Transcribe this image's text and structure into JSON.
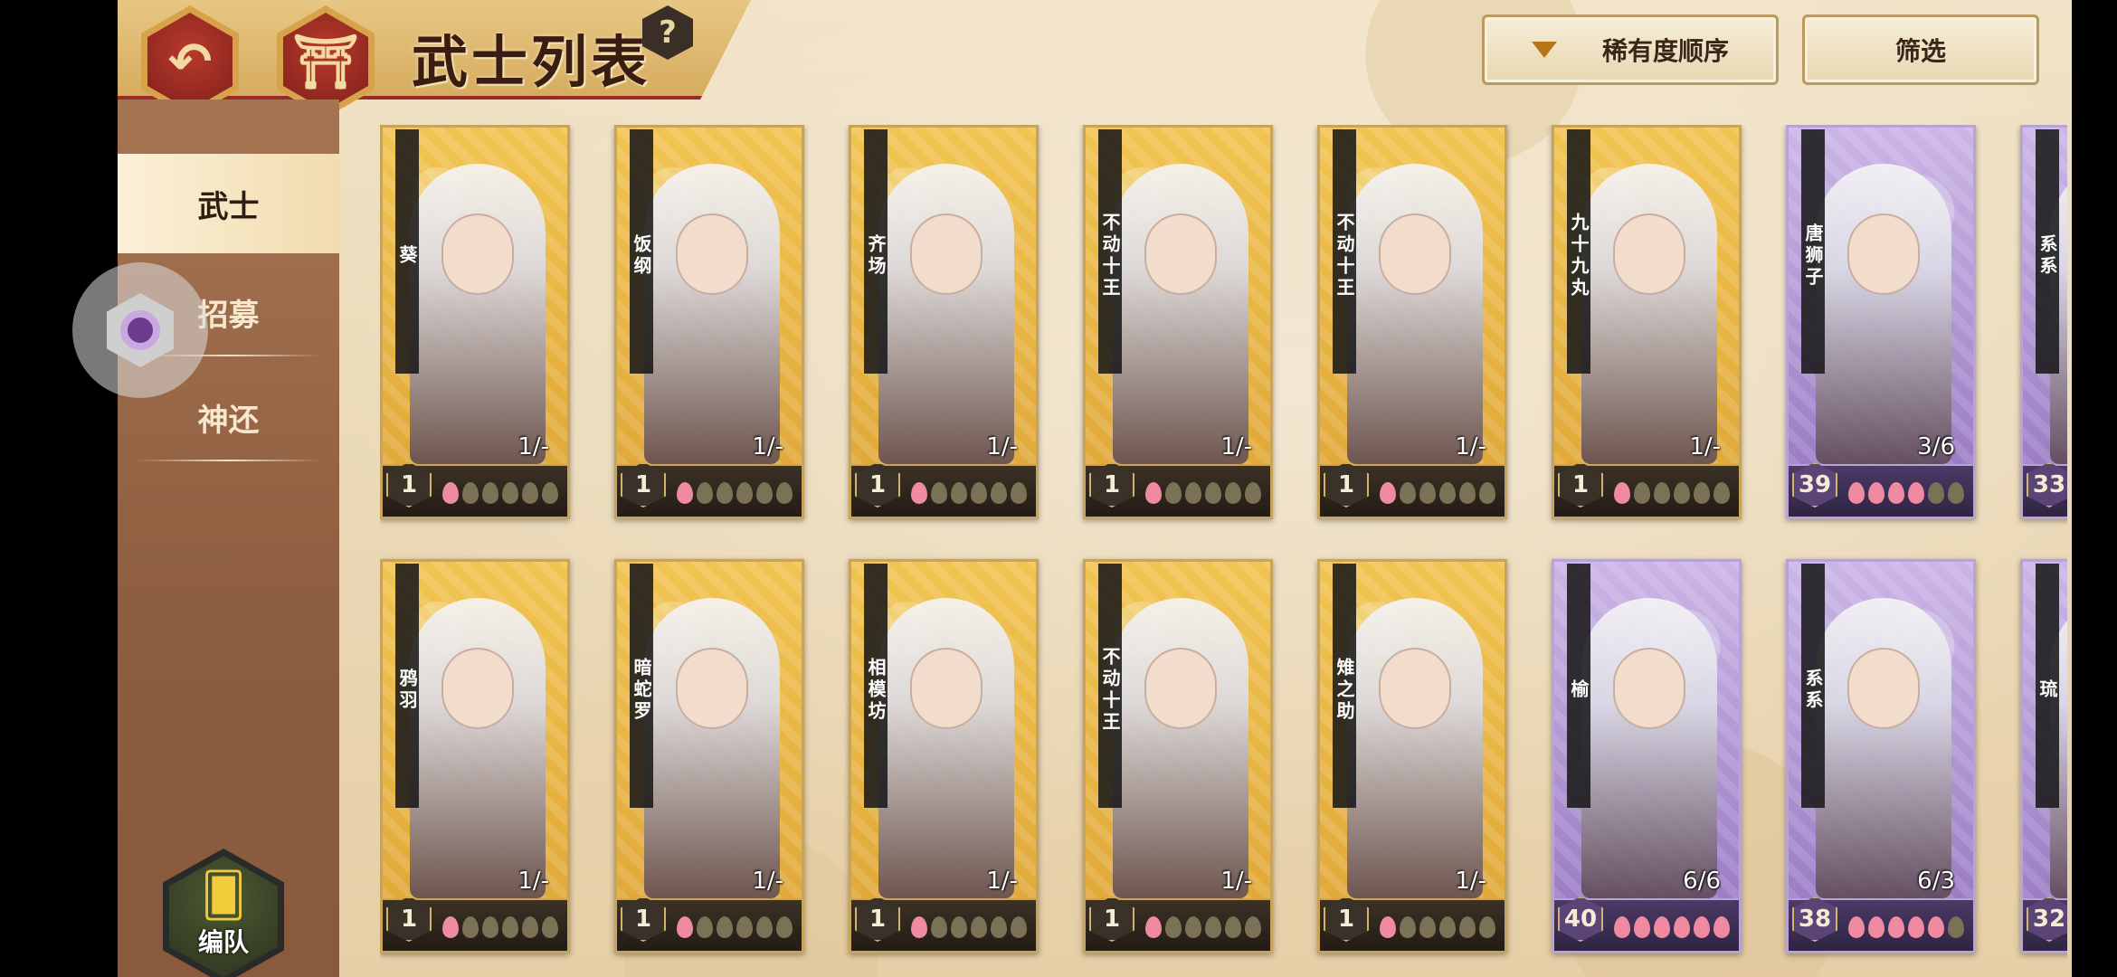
{
  "header": {
    "title": "武士列表",
    "back_icon": "back-arrow-icon",
    "home_icon": "torii-home-icon",
    "help_label": "?"
  },
  "toolbar": {
    "sort_label": "稀有度顺序",
    "filter_label": "筛选"
  },
  "sidebar": {
    "items": [
      {
        "label": "武士",
        "active": true
      },
      {
        "label": "招募",
        "active": false
      },
      {
        "label": "神还",
        "active": false
      }
    ],
    "team_button_label": "编队"
  },
  "colors": {
    "accent_red": "#9b2a2a",
    "gold": "#d6ac5f",
    "sidebar_brown": "#8d5d3f",
    "petal_pink": "#ef8aa1"
  },
  "cards": [
    {
      "name": "葵",
      "level": "1",
      "count": "1/-",
      "petals_total": 6,
      "petals_on": 1,
      "rarity": "gold"
    },
    {
      "name": "饭纲",
      "level": "1",
      "count": "1/-",
      "petals_total": 6,
      "petals_on": 1,
      "rarity": "gold"
    },
    {
      "name": "齐场",
      "level": "1",
      "count": "1/-",
      "petals_total": 6,
      "petals_on": 1,
      "rarity": "gold"
    },
    {
      "name": "不动十王",
      "level": "1",
      "count": "1/-",
      "petals_total": 6,
      "petals_on": 1,
      "rarity": "gold"
    },
    {
      "name": "不动十王",
      "level": "1",
      "count": "1/-",
      "petals_total": 6,
      "petals_on": 1,
      "rarity": "gold"
    },
    {
      "name": "九十九丸",
      "level": "1",
      "count": "1/-",
      "petals_total": 6,
      "petals_on": 1,
      "rarity": "gold"
    },
    {
      "name": "唐狮子",
      "level": "39",
      "count": "3/6",
      "petals_total": 6,
      "petals_on": 4,
      "rarity": "purple"
    },
    {
      "name": "系系",
      "level": "33",
      "count": "",
      "petals_total": 6,
      "petals_on": 4,
      "rarity": "purple"
    },
    {
      "name": "鸦羽",
      "level": "1",
      "count": "1/-",
      "petals_total": 6,
      "petals_on": 1,
      "rarity": "gold"
    },
    {
      "name": "暗蛇罗",
      "level": "1",
      "count": "1/-",
      "petals_total": 6,
      "petals_on": 1,
      "rarity": "gold"
    },
    {
      "name": "相模坊",
      "level": "1",
      "count": "1/-",
      "petals_total": 6,
      "petals_on": 1,
      "rarity": "gold"
    },
    {
      "name": "不动十王",
      "level": "1",
      "count": "1/-",
      "petals_total": 6,
      "petals_on": 1,
      "rarity": "gold"
    },
    {
      "name": "雉之助",
      "level": "1",
      "count": "1/-",
      "petals_total": 6,
      "petals_on": 1,
      "rarity": "gold"
    },
    {
      "name": "榆",
      "level": "40",
      "count": "6/6",
      "petals_total": 6,
      "petals_on": 6,
      "rarity": "purple"
    },
    {
      "name": "系系",
      "level": "38",
      "count": "6/3",
      "petals_total": 6,
      "petals_on": 5,
      "rarity": "purple"
    },
    {
      "name": "琉",
      "level": "32",
      "count": "",
      "petals_total": 6,
      "petals_on": 4,
      "rarity": "purple"
    }
  ]
}
